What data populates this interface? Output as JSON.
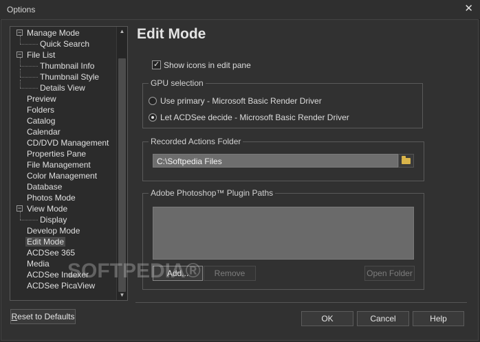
{
  "window": {
    "title": "Options",
    "close_glyph": "✕"
  },
  "tree": {
    "items": [
      {
        "label": "Manage Mode",
        "level": 0,
        "expander": "−"
      },
      {
        "label": "Quick Search",
        "level": 1
      },
      {
        "label": "File List",
        "level": 0,
        "expander": "−"
      },
      {
        "label": "Thumbnail Info",
        "level": 1
      },
      {
        "label": "Thumbnail Style",
        "level": 1
      },
      {
        "label": "Details View",
        "level": 1
      },
      {
        "label": "Preview",
        "level": 0
      },
      {
        "label": "Folders",
        "level": 0
      },
      {
        "label": "Catalog",
        "level": 0
      },
      {
        "label": "Calendar",
        "level": 0
      },
      {
        "label": "CD/DVD Management",
        "level": 0
      },
      {
        "label": "Properties Pane",
        "level": 0
      },
      {
        "label": "File Management",
        "level": 0
      },
      {
        "label": "Color Management",
        "level": 0
      },
      {
        "label": "Database",
        "level": 0
      },
      {
        "label": "Photos Mode",
        "level": 0
      },
      {
        "label": "View Mode",
        "level": 0,
        "expander": "−"
      },
      {
        "label": "Display",
        "level": 1
      },
      {
        "label": "Develop Mode",
        "level": 0
      },
      {
        "label": "Edit Mode",
        "level": 0,
        "selected": true
      },
      {
        "label": "ACDSee 365",
        "level": 0
      },
      {
        "label": "Media",
        "level": 0
      },
      {
        "label": "ACDSee Indexer",
        "level": 0
      },
      {
        "label": "ACDSee PicaView",
        "level": 0
      }
    ],
    "scroll_up_glyph": "▲",
    "scroll_down_glyph": "▼"
  },
  "panel": {
    "heading": "Edit Mode",
    "show_icons_label": "Show icons in edit pane",
    "gpu_group": {
      "label": "GPU selection",
      "options": [
        "Use primary - Microsoft Basic Render Driver",
        "Let ACDSee decide - Microsoft Basic Render Driver"
      ]
    },
    "actions_group": {
      "label": "Recorded Actions Folder",
      "path": "C:\\Softpedia Files"
    },
    "plugin_group": {
      "label": "Adobe Photoshop™ Plugin Paths",
      "add": "Add...",
      "remove": "Remove",
      "open_folder": "Open Folder"
    }
  },
  "footer": {
    "reset_prefix": "R",
    "reset_rest": "eset to Defaults",
    "ok": "OK",
    "cancel": "Cancel",
    "help": "Help"
  },
  "watermark": "SOFTPEDIA®"
}
